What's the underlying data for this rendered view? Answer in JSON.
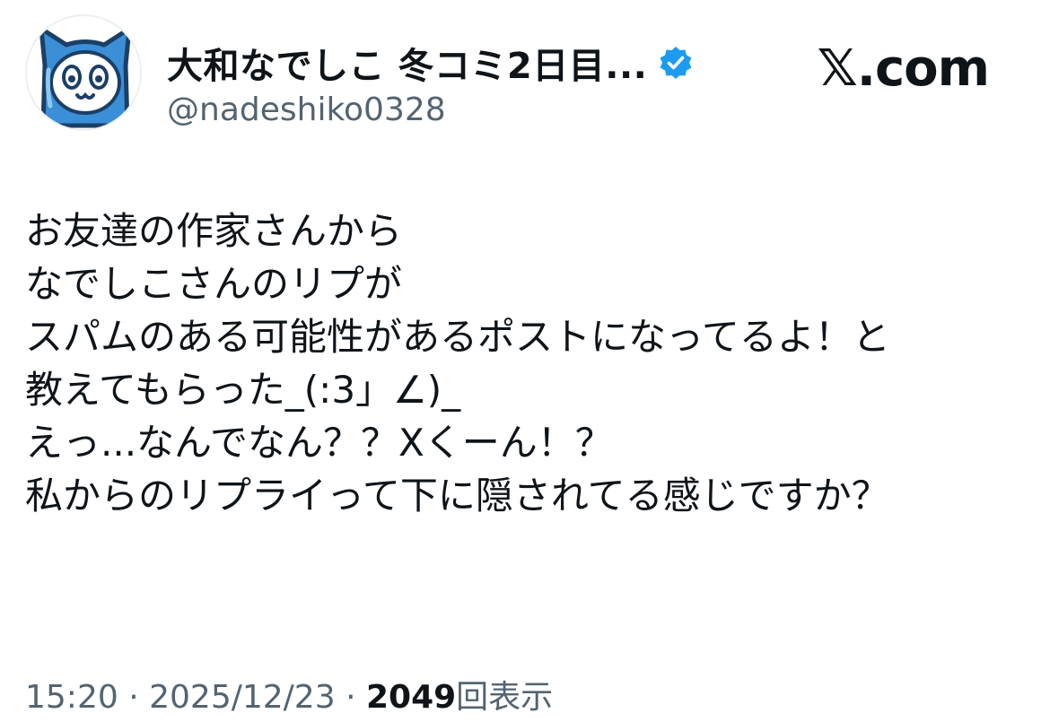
{
  "post": {
    "author": {
      "display_name": "大和なでしこ 冬コミ2日目...",
      "handle": "@nadeshiko0328",
      "verified": true,
      "avatar_icon": "blue-cat-mascot-avatar"
    },
    "site_label": "𝕏.com",
    "lines": [
      "お友達の作家さんから",
      "なでしこさんのリプが",
      "スパムのある可能性があるポストになってるよ！と",
      "教えてもらった_(:3」∠)_",
      "えっ...なんでなん？？Xくーん！？",
      "私からのリプライって下に隠されてる感じですか？"
    ],
    "time": "15:20",
    "date": "2025/12/23",
    "separator": "·",
    "view_count": "2049",
    "view_label": "回表示"
  },
  "colors": {
    "text": "#0f1419",
    "muted": "#536471",
    "verified_blue": "#1d9bf0",
    "mascot_blue": "#3a8fd6"
  }
}
